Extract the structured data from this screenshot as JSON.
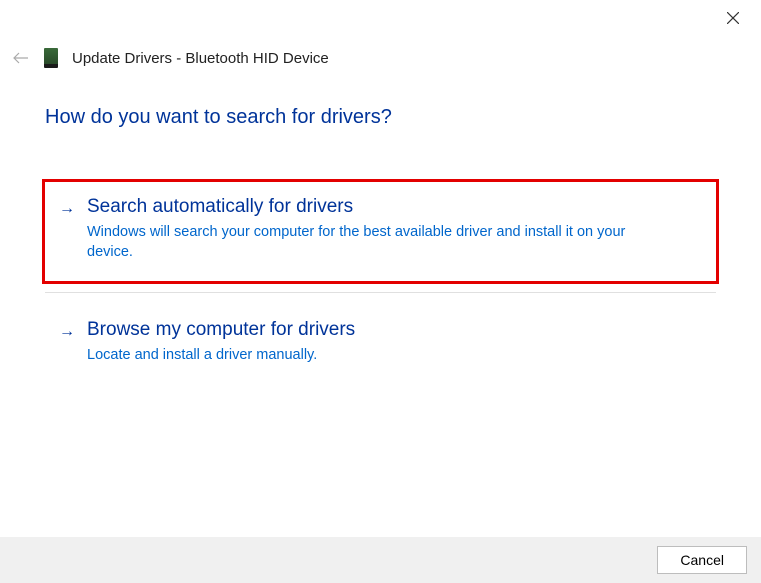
{
  "header": {
    "title": "Update Drivers - Bluetooth HID Device"
  },
  "question": "How do you want to search for drivers?",
  "options": [
    {
      "title": "Search automatically for drivers",
      "description": "Windows will search your computer for the best available driver and install it on your device."
    },
    {
      "title": "Browse my computer for drivers",
      "description": "Locate and install a driver manually."
    }
  ],
  "footer": {
    "cancel_label": "Cancel"
  }
}
